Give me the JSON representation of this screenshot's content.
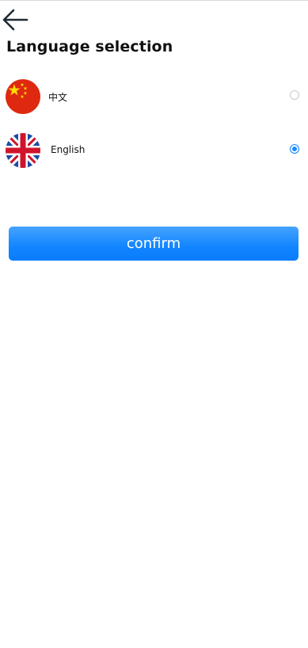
{
  "header": {
    "back_icon": "arrow-left-icon",
    "title": "Language selection"
  },
  "languages": [
    {
      "label": "中文",
      "flag_icon": "china-flag-icon",
      "selected": false
    },
    {
      "label": "English",
      "flag_icon": "uk-flag-icon",
      "selected": true
    }
  ],
  "confirm_label": "confirm",
  "colors": {
    "accent": "#1a8cff",
    "button_top": "#45a3ff",
    "button_bottom": "#0a7dfb",
    "radio_unselected_border": "#c9c9c9"
  }
}
